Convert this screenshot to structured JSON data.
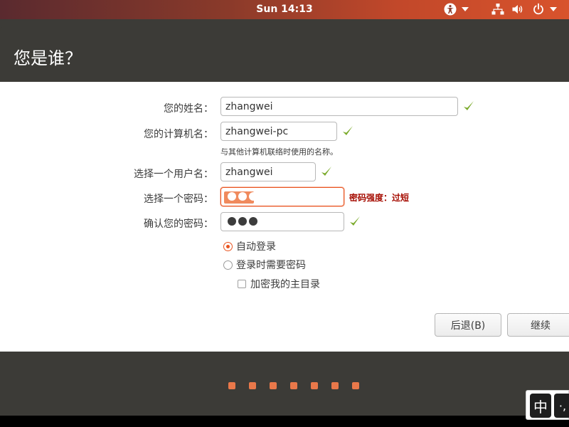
{
  "topbar": {
    "clock": "Sun 14:13",
    "icons": [
      "accessibility-icon",
      "network-icon",
      "volume-icon",
      "power-icon"
    ]
  },
  "window": {
    "title": "您是谁？"
  },
  "form": {
    "name_label": "您的姓名：",
    "name_value": "zhangwei",
    "computer_label": "您的计算机名：",
    "computer_value": "zhangwei-pc",
    "computer_hint": "与其他计算机联络时使用的名称。",
    "username_label": "选择一个用户名：",
    "username_value": "zhangwei",
    "password_label": "选择一个密码：",
    "password_length": 3,
    "strength_text": "密码强度：过短",
    "confirm_label": "确认您的密码：",
    "confirm_length": 3,
    "login_options": [
      {
        "label": "自动登录",
        "selected": true
      },
      {
        "label": "登录时需要密码",
        "selected": false
      }
    ],
    "encrypt_label": "加密我的主目录",
    "encrypt_checked": false
  },
  "buttons": {
    "back_label": "后退(B)",
    "continue_label": "继续"
  },
  "progress": {
    "steps": 7
  },
  "ime": {
    "mode_label": "中",
    "punct_label": "·,"
  },
  "colors": {
    "accent": "#e95420",
    "valid_check": "#7aaa2a",
    "strength_warning": "#a50b00",
    "chrome_dark": "#3c3b37"
  }
}
